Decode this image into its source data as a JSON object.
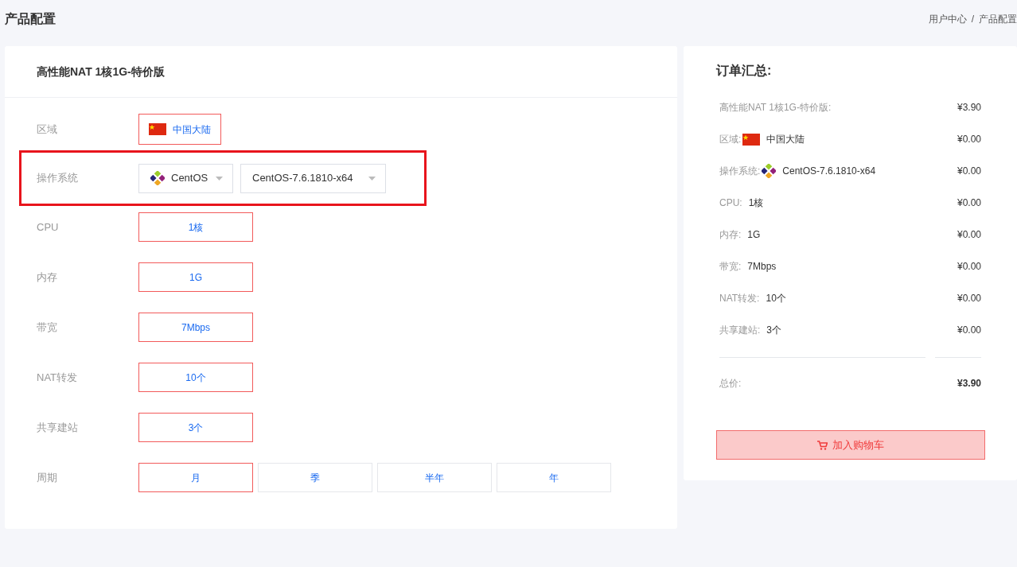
{
  "page_title": "产品配置",
  "breadcrumb": [
    {
      "label": "用户中心"
    },
    {
      "label": "产品配置"
    }
  ],
  "breadcrumb_separator": "/",
  "product": {
    "title": "高性能NAT 1核1G-特价版"
  },
  "config_rows": [
    {
      "kind": "region",
      "label": "区域",
      "highlighted": false,
      "options": [
        {
          "label": "中国大陆",
          "selected": true
        }
      ]
    },
    {
      "kind": "os",
      "label": "操作系统",
      "highlighted": true,
      "selects": [
        {
          "value": "CentOS"
        },
        {
          "value": "CentOS-7.6.1810-x64"
        }
      ]
    },
    {
      "kind": "options",
      "label": "CPU",
      "highlighted": false,
      "options": [
        {
          "label": "1核",
          "selected": true
        }
      ]
    },
    {
      "kind": "options",
      "label": "内存",
      "highlighted": false,
      "options": [
        {
          "label": "1G",
          "selected": true
        }
      ]
    },
    {
      "kind": "options",
      "label": "带宽",
      "highlighted": false,
      "options": [
        {
          "label": "7Mbps",
          "selected": true
        }
      ]
    },
    {
      "kind": "options",
      "label": "NAT转发",
      "highlighted": false,
      "options": [
        {
          "label": "10个",
          "selected": true
        }
      ]
    },
    {
      "kind": "options",
      "label": "共享建站",
      "highlighted": false,
      "options": [
        {
          "label": "3个",
          "selected": true
        }
      ]
    },
    {
      "kind": "options",
      "label": "周期",
      "highlighted": false,
      "options": [
        {
          "label": "月",
          "selected": true
        },
        {
          "label": "季",
          "selected": false
        },
        {
          "label": "半年",
          "selected": false
        },
        {
          "label": "年",
          "selected": false
        }
      ]
    }
  ],
  "summary": {
    "title": "订单汇总:",
    "items": [
      {
        "kind": "product",
        "label": "高性能NAT 1核1G-特价版:",
        "price": "¥3.90"
      },
      {
        "kind": "region",
        "label": "区域:",
        "value": "中国大陆",
        "price": "¥0.00"
      },
      {
        "kind": "os",
        "label": "操作系统:",
        "value": "CentOS-7.6.1810-x64",
        "price": "¥0.00"
      },
      {
        "kind": "plain",
        "label": "CPU:",
        "value": "1核",
        "price": "¥0.00"
      },
      {
        "kind": "plain",
        "label": "内存:",
        "value": "1G",
        "price": "¥0.00"
      },
      {
        "kind": "plain",
        "label": "带宽:",
        "value": "7Mbps",
        "price": "¥0.00"
      },
      {
        "kind": "plain",
        "label": "NAT转发:",
        "value": "10个",
        "price": "¥0.00"
      },
      {
        "kind": "plain",
        "label": "共享建站:",
        "value": "3个",
        "price": "¥0.00"
      }
    ],
    "total_label": "总价:",
    "total_price": "¥3.90",
    "cart_button": "加入购物车"
  }
}
